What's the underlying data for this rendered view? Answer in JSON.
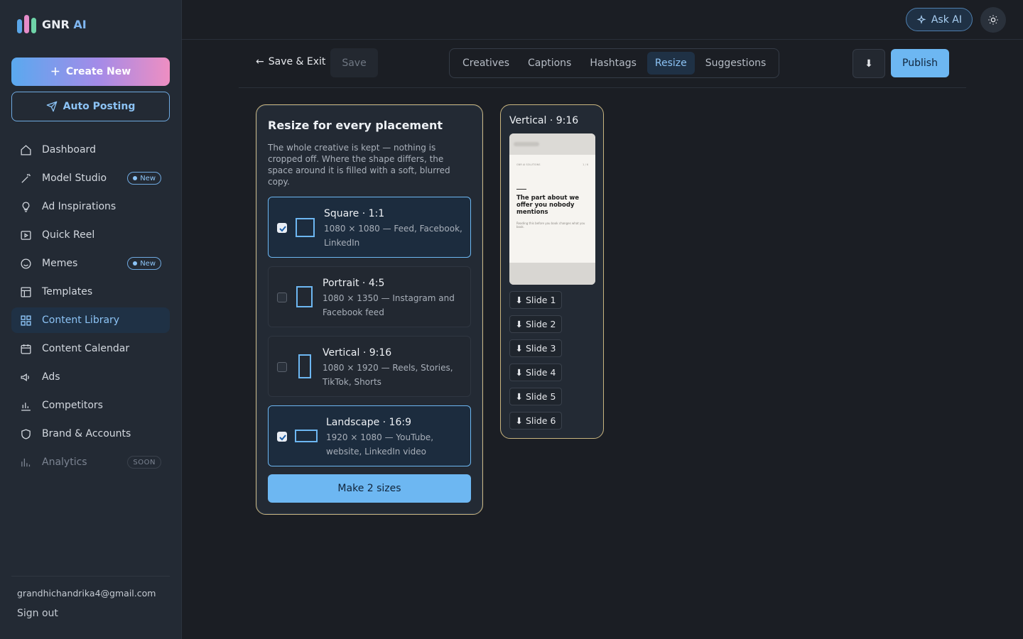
{
  "app": {
    "name": "GNR",
    "name_suffix": "AI"
  },
  "sidebar": {
    "create_new": "Create New",
    "auto_posting": "Auto Posting",
    "items": [
      {
        "label": "Dashboard",
        "icon": "home-icon"
      },
      {
        "label": "Model Studio",
        "icon": "wand-icon",
        "badge": "New"
      },
      {
        "label": "Ad Inspirations",
        "icon": "lightbulb-icon"
      },
      {
        "label": "Quick Reel",
        "icon": "play-icon"
      },
      {
        "label": "Memes",
        "icon": "smile-icon",
        "badge": "New"
      },
      {
        "label": "Templates",
        "icon": "layout-icon"
      },
      {
        "label": "Content Library",
        "icon": "grid-icon",
        "active": true
      },
      {
        "label": "Content Calendar",
        "icon": "calendar-icon"
      },
      {
        "label": "Ads",
        "icon": "megaphone-icon"
      },
      {
        "label": "Competitors",
        "icon": "bar-chart-icon"
      },
      {
        "label": "Brand & Accounts",
        "icon": "shield-icon"
      },
      {
        "label": "Analytics",
        "icon": "analytics-icon",
        "badge": "SOON"
      }
    ],
    "user_email": "grandhichandrika4@gmail.com",
    "sign_out": "Sign out"
  },
  "topbar": {
    "ask_ai": "Ask AI"
  },
  "toolbar": {
    "save_exit": "Save & Exit",
    "save": "Save",
    "tabs": [
      "Creatives",
      "Captions",
      "Hashtags",
      "Resize",
      "Suggestions"
    ],
    "active_tab": "Resize",
    "download_glyph": "⬇",
    "publish": "Publish"
  },
  "resize": {
    "title": "Resize for every placement",
    "description": "The whole creative is kept — nothing is cropped off. Where the shape differs, the space around it is filled with a soft, blurred copy.",
    "options": [
      {
        "name": "Square · 1:1",
        "sub": "1080 × 1080 — Feed, Facebook, LinkedIn",
        "checked": true
      },
      {
        "name": "Portrait · 4:5",
        "sub": "1080 × 1350 — Instagram and Facebook feed",
        "checked": false
      },
      {
        "name": "Vertical · 9:16",
        "sub": "1080 × 1920 — Reels, Stories, TikTok, Shorts",
        "checked": false
      },
      {
        "name": "Landscape · 16:9",
        "sub": "1920 × 1080 — YouTube, website, LinkedIn video",
        "checked": true
      }
    ],
    "make_button": "Make 2 sizes"
  },
  "preview": {
    "title": "Vertical · 9:16",
    "thumb_meta_left": "GNR AI SOLUTIONS",
    "thumb_meta_right": "1 / 6",
    "thumb_heading": "The part about we offer you nobody mentions",
    "thumb_body": "Reading this before you book changes what you book.",
    "slides": [
      "⬇ Slide 1",
      "⬇ Slide 2",
      "⬇ Slide 3",
      "⬇ Slide 4",
      "⬇ Slide 5",
      "⬇ Slide 6"
    ]
  },
  "colors": {
    "accent": "#6db7f2",
    "border_gold": "#c9b57f",
    "bg": "#1b1e24",
    "sidebar": "#232a34"
  }
}
